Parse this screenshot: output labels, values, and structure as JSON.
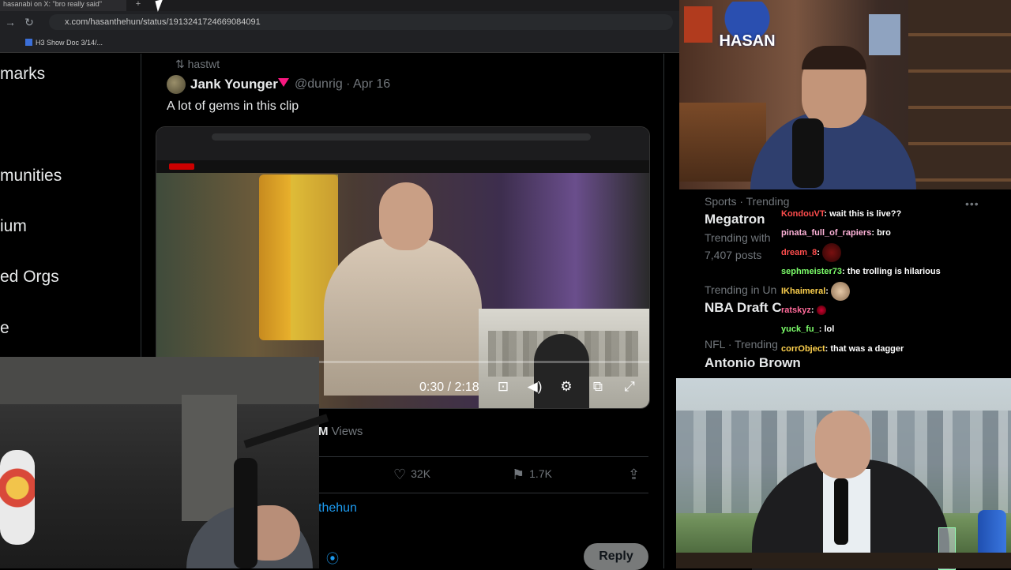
{
  "browser": {
    "tab_title": "hasanabi on X: \"bro really said\"",
    "new_tab": "+",
    "url": "x.com/hasanthehun/status/1913241724669084091",
    "bookmark": "H3 Show Doc 3/14/..."
  },
  "sidebar": {
    "items": [
      {
        "label": "marks"
      },
      {
        "label": "munities"
      },
      {
        "label": "ium"
      },
      {
        "label": "ed Orgs"
      },
      {
        "label": "e"
      }
    ]
  },
  "tweet": {
    "repost_label": "hastwt",
    "author_name": "Jank Younger",
    "handle_date": "@dunrig · Apr 16",
    "text": "A lot of gems in this clip",
    "video_time": "0:30 / 2:18",
    "views_count": "M",
    "views_label": "Views",
    "likes": "32K",
    "bookmarks": "1.7K",
    "reply_to": "thehun",
    "reply_button": "Reply"
  },
  "trends": [
    {
      "meta": "Sports · Trending",
      "name": "Megatron",
      "sub": "Trending with",
      "posts": "7,407 posts"
    },
    {
      "meta": "Trending in Un",
      "name": "NBA Draft C"
    },
    {
      "meta": "NFL · Trending",
      "name": "Antonio Brown"
    }
  ],
  "chat": [
    {
      "user": "KondouVT",
      "msg": "wait this is live??",
      "color": "#ff4d4d"
    },
    {
      "user": "pinata_full_of_rapiers",
      "msg": "bro",
      "color": "#ffb3d9"
    },
    {
      "user": "dream_8",
      "msg": "",
      "color": "#ff4d4d",
      "emote": true
    },
    {
      "user": "sephmeister73",
      "msg": "the trolling is hilarious",
      "color": "#7dff6b"
    },
    {
      "user": "IKhaimeral",
      "msg": "",
      "color": "#ffd24d",
      "emote": true
    },
    {
      "user": "ratskyz",
      "msg": "",
      "color": "#ff6b9a",
      "emote": true
    },
    {
      "user": "yuck_fu_",
      "msg": "lol",
      "color": "#7dff6b"
    },
    {
      "user": "corrObject",
      "msg": "that was a dagger",
      "color": "#ffd24d"
    }
  ],
  "overlay": {
    "hasan_logo": "HASAN"
  },
  "colors": {
    "accent": "#1d9bf0",
    "verified": "#f91880",
    "muted": "#71767b"
  }
}
